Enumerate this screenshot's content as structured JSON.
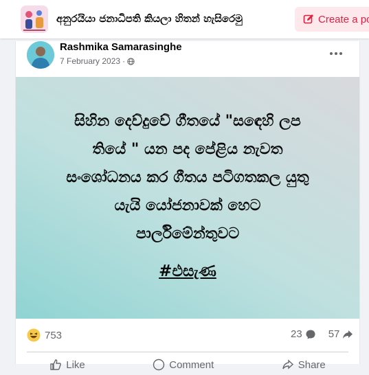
{
  "group": {
    "name": "අනුරයියා ජනාධිපති කියලා හිතන් හැසිරෙමු",
    "avatar_icon": "group-illustration-icon"
  },
  "topbar": {
    "create_label": "Create a post",
    "create_icon": "edit-icon",
    "accent": "#e41e3f"
  },
  "post": {
    "author": "Rashmika Samarasinghe",
    "date": "7 February 2023",
    "separator": "·",
    "privacy_icon": "globe-icon",
    "more_icon": "more-options-icon",
    "image": {
      "lines": [
        "සිහින දෙව්දුවේ ගීතයේ \"සඳෙහි ලප",
        "තියේ \" යන පද පේළිය නැවත",
        "සංශෝධනය කර ගීතය පටිගතකල යුතු",
        "යැයි යෝජනාවක් හෙට",
        "පාර්ලිමේන්තුවට"
      ],
      "hashtag": "#එසැණ",
      "bg_colors": [
        "#8fd4d3",
        "#d9d9dc"
      ]
    },
    "stats": {
      "reaction_icon": "haha-emoji-icon",
      "reactions": "753",
      "comments": "23",
      "comment_icon": "comment-icon",
      "shares": "57",
      "share_icon": "share-arrow-icon"
    },
    "actions": {
      "like_label": "Like",
      "comment_label": "Comment",
      "share_label": "Share"
    }
  }
}
